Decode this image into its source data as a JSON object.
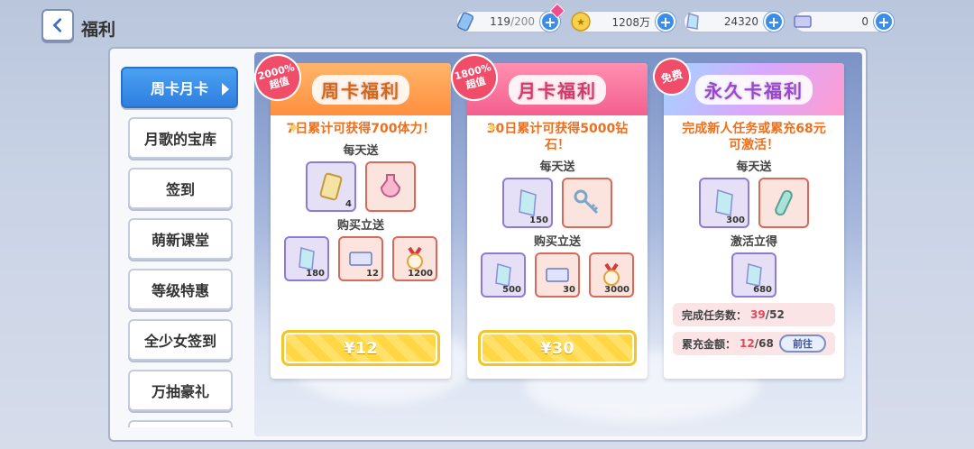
{
  "header": {
    "title": "福利",
    "back_icon": "back-arrow-icon",
    "resources": [
      {
        "icon": "stamina-bottle-icon",
        "value": "119",
        "max": "/200"
      },
      {
        "icon": "coin-icon",
        "value": "1208万"
      },
      {
        "icon": "diamond-icon",
        "value": "24320"
      },
      {
        "icon": "ticket-icon",
        "value": "0"
      }
    ]
  },
  "sidebar": {
    "items": [
      {
        "label": "周卡月卡",
        "active": true
      },
      {
        "label": "月歌的宝库"
      },
      {
        "label": "签到"
      },
      {
        "label": "萌新课堂"
      },
      {
        "label": "等级特惠"
      },
      {
        "label": "全少女签到"
      },
      {
        "label": "万抽豪礼"
      }
    ]
  },
  "cards": [
    {
      "title": "周卡福利",
      "badge_line1": "2000%",
      "badge_line2": "超值",
      "desc": "7日累计可获得700体力！",
      "daily_label": "每天送",
      "daily_items": [
        {
          "icon": "stamina-card-icon",
          "count": "4"
        },
        {
          "icon": "potion-bottle-icon",
          "count": ""
        }
      ],
      "buy_label": "购买立送",
      "buy_items": [
        {
          "icon": "diamond-icon",
          "count": "180"
        },
        {
          "icon": "ticket-icon",
          "count": "12"
        },
        {
          "icon": "ribbon-medal-icon",
          "count": "1200"
        }
      ],
      "price": "¥12"
    },
    {
      "title": "月卡福利",
      "badge_line1": "1800%",
      "badge_line2": "超值",
      "desc": "30日累计可获得5000钻石！",
      "daily_label": "每天送",
      "daily_items": [
        {
          "icon": "diamond-icon",
          "count": "150"
        },
        {
          "icon": "key-icon",
          "count": ""
        }
      ],
      "buy_label": "购买立送",
      "buy_items": [
        {
          "icon": "diamond-icon",
          "count": "500"
        },
        {
          "icon": "ticket-icon",
          "count": "30"
        },
        {
          "icon": "ribbon-medal-icon",
          "count": "3000"
        }
      ],
      "price": "¥30"
    },
    {
      "title": "永久卡福利",
      "badge_line1": "免费",
      "desc": "完成新人任务或累充68元可激活！",
      "daily_label": "每天送",
      "daily_items": [
        {
          "icon": "diamond-icon",
          "count": "300"
        },
        {
          "icon": "capsule-icon",
          "count": ""
        }
      ],
      "buy_label": "激活立得",
      "buy_items": [
        {
          "icon": "diamond-icon",
          "count": "680"
        }
      ],
      "task_label": "完成任务数：",
      "task_done": "39",
      "task_total": "/52",
      "charge_label": "累充金额：",
      "charge_done": "12",
      "charge_total": "/68",
      "go_label": "前往"
    }
  ]
}
